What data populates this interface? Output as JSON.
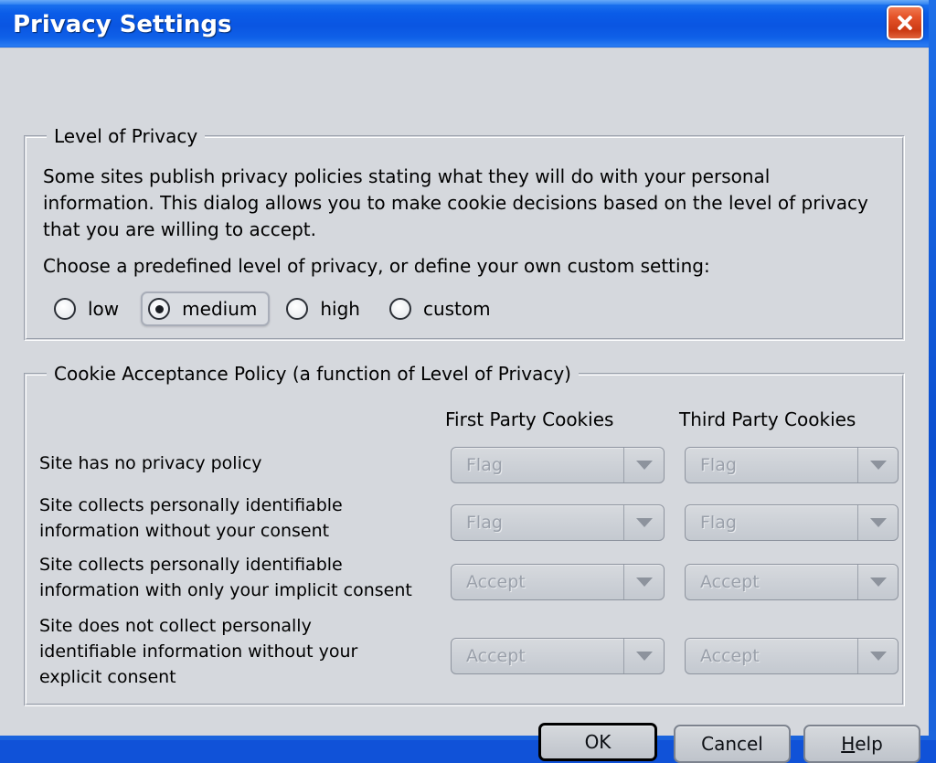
{
  "window": {
    "title": "Privacy Settings",
    "close_icon": "close-icon",
    "accent_titlebar": "#0a55e2",
    "close_color": "#cc3a14",
    "dialog_bg": "#d5d8dd"
  },
  "privacy_group": {
    "title": "Level of Privacy",
    "description": "Some sites publish privacy policies stating what they will do with your personal information. This dialog allows you to make cookie decisions based on the level of privacy that you are willing to accept.",
    "choose_prompt": "Choose a predefined level of privacy, or define your own custom setting:",
    "options": [
      {
        "label": "low",
        "checked": false,
        "focused": false
      },
      {
        "label": "medium",
        "checked": true,
        "focused": true
      },
      {
        "label": "high",
        "checked": false,
        "focused": false
      },
      {
        "label": "custom",
        "checked": false,
        "focused": false
      }
    ]
  },
  "cookie_group": {
    "title": "Cookie Acceptance Policy (a function of Level of Privacy)",
    "columns": [
      {
        "label": "First Party Cookies"
      },
      {
        "label": "Third Party Cookies"
      }
    ],
    "rows": [
      {
        "label": "Site has no privacy policy",
        "first_party": {
          "value": "Flag",
          "disabled": true
        },
        "third_party": {
          "value": "Flag",
          "disabled": true
        }
      },
      {
        "label": "Site collects personally identifiable\ninformation without your consent",
        "first_party": {
          "value": "Flag",
          "disabled": true
        },
        "third_party": {
          "value": "Flag",
          "disabled": true
        }
      },
      {
        "label": "Site collects personally identifiable\ninformation with only your implicit consent",
        "first_party": {
          "value": "Accept",
          "disabled": true
        },
        "third_party": {
          "value": "Accept",
          "disabled": true
        }
      },
      {
        "label": "Site does not collect personally\nidentifiable information without your\nexplicit consent",
        "first_party": {
          "value": "Accept",
          "disabled": true
        },
        "third_party": {
          "value": "Accept",
          "disabled": true
        }
      }
    ]
  },
  "buttons": {
    "ok": "OK",
    "cancel": "Cancel",
    "help_mnemonic": "H",
    "help_rest": "elp"
  }
}
